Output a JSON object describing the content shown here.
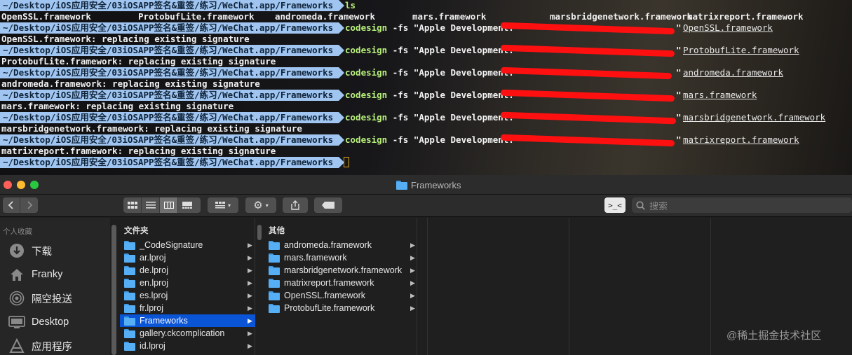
{
  "terminal": {
    "ls_prompt": "~/Desktop/iOS应用安全/03iOSAPP签名&重签/练习/WeChat.app/Frameworks",
    "ls_cmd": "ls",
    "ls_items": [
      "OpenSSL.framework",
      "ProtobufLite.framework",
      "andromeda.framework",
      "mars.framework",
      "marsbridgenetwork.framework",
      "matrixreport.framework"
    ],
    "prompt": "~/Desktop/iOS应用安全/03iOSAPP签名&重签/练习/WeChat.app/Frameworks",
    "cmd_keyword": "codesign",
    "cmd_flag": " -fs \"Apple Development: ",
    "commands": [
      {
        "framework": "OpenSSL.framework",
        "output": "OpenSSL.framework: replacing existing signature"
      },
      {
        "framework": "ProtobufLite.framework",
        "output": "ProtobufLite.framework: replacing existing signature"
      },
      {
        "framework": "andromeda.framework",
        "output": "andromeda.framework: replacing existing signature"
      },
      {
        "framework": "mars.framework",
        "output": "mars.framework: replacing existing signature"
      },
      {
        "framework": "marsbridgenetwork.framework",
        "output": "marsbridgenetwork.framework: replacing existing signature"
      },
      {
        "framework": "matrixreport.framework",
        "output": "matrixreport.framework: replacing existing signature"
      }
    ],
    "closing_quote": "\"",
    "colors": {
      "prompt_bg": "#9fc5f0",
      "keyword": "#b8f07a",
      "redaction": "#ff1010",
      "cursor": "#e0a020"
    }
  },
  "finder": {
    "window_title": "Frameworks",
    "search_placeholder": "搜索",
    "sidebar": {
      "heading": "个人收藏",
      "items": [
        {
          "label": "下载",
          "icon": "download-icon"
        },
        {
          "label": "Franky",
          "icon": "home-icon"
        },
        {
          "label": "隔空投送",
          "icon": "airdrop-icon"
        },
        {
          "label": "Desktop",
          "icon": "desktop-icon"
        },
        {
          "label": "应用程序",
          "icon": "applications-icon"
        }
      ]
    },
    "column1": {
      "heading": "文件夹",
      "items": [
        "_CodeSignature",
        "ar.lproj",
        "de.lproj",
        "en.lproj",
        "es.lproj",
        "fr.lproj",
        "Frameworks",
        "gallery.ckcomplication",
        "id.lproj"
      ],
      "selected": "Frameworks"
    },
    "column2": {
      "heading": "其他",
      "items": [
        "andromeda.framework",
        "mars.framework",
        "marsbridgenetwork.framework",
        "matrixreport.framework",
        "OpenSSL.framework",
        "ProtobufLite.framework"
      ]
    },
    "colors": {
      "selection": "#0a54d6",
      "folder": "#56aef5"
    }
  },
  "watermark": "@稀土掘金技术社区"
}
